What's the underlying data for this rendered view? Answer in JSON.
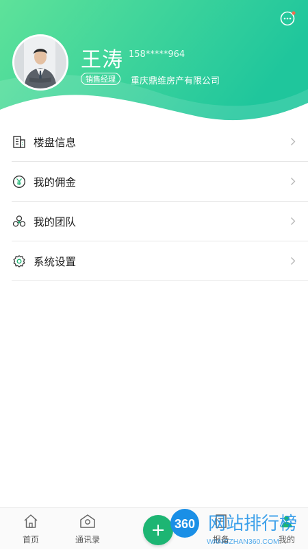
{
  "header": {
    "name": "王涛",
    "phone": "158*****964",
    "role": "销售经理",
    "company": "重庆鼎维房产有限公司"
  },
  "menu": {
    "items": [
      {
        "label": "楼盘信息",
        "icon": "building-icon"
      },
      {
        "label": "我的佣金",
        "icon": "yen-icon"
      },
      {
        "label": "我的团队",
        "icon": "team-icon"
      },
      {
        "label": "系统设置",
        "icon": "gear-icon"
      }
    ]
  },
  "tabbar": {
    "items": [
      {
        "label": "首页",
        "icon": "home-icon"
      },
      {
        "label": "通讯录",
        "icon": "contacts-icon"
      },
      {
        "label": "报备",
        "icon": "report-icon"
      },
      {
        "label": "我的",
        "icon": "profile-icon"
      }
    ]
  },
  "watermark": {
    "logo": "360",
    "text": "网站排行榜",
    "sub": "WANGZHAN360.COM"
  },
  "colors": {
    "gradient_start": "#5ee29a",
    "gradient_end": "#1fc69c",
    "accent": "#1db573"
  }
}
